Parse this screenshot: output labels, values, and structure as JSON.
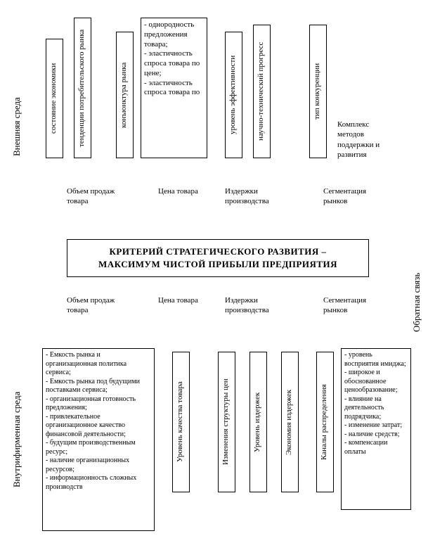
{
  "side_left_outer": "Внешняя среда",
  "side_right_outer": "Обратная связь",
  "side_left_lower": "Внутрифирменная среда",
  "top": {
    "vbox1": "состояние экономики",
    "vbox2": "тенденции потребительского рынка",
    "vbox3": "конъюнктура рынка",
    "col3_list": "- однородность предложения товара;\n- эластичность спроса товара по цене;\n- эластичность спроса товара по",
    "vbox4": "уровень эффективности",
    "vbox5": "научно-технический прогресс",
    "vbox6": "тип конкуренции",
    "col4_text": "Комплекс методов поддержки и развития"
  },
  "mid_labels": {
    "c1": "Объем продаж товара",
    "c2": "Цена товара",
    "c3": "Издержки производства",
    "c4": "Сегментация рынков"
  },
  "center": {
    "line1": "КРИТЕРИЙ СТРАТЕГИЧЕСКОГО РАЗВИТИЯ –",
    "line2": "МАКСИМУМ ЧИСТОЙ ПРИБЫЛИ ПРЕДПРИЯТИЯ"
  },
  "bottom": {
    "col1_list": "- Емкость рынка и организационная политика сервиса;\n- Емкость рынка под будущими поставками сервиса;\n- организационная готовность предложения;\n- привлекательное организационное качество финансовой деятельности;\n- будущим производственным ресурс;\n- наличие организационных ресурсов;\n- информационность сложных производств",
    "vbox2": "Уровень качества товара",
    "vbox3": "Изменения структуры цен",
    "vbox4": "Уровень издержек",
    "vbox5": "Экономия издержек",
    "vbox6": "Каналы распределения",
    "col4_list": "- уровень восприятия имиджа;\n- широкое и обоснованное ценообразование;\n- влияние на деятельность подрядчика;\n- изменение затрат;\n- наличие средств;\n- компенсации оплаты"
  }
}
